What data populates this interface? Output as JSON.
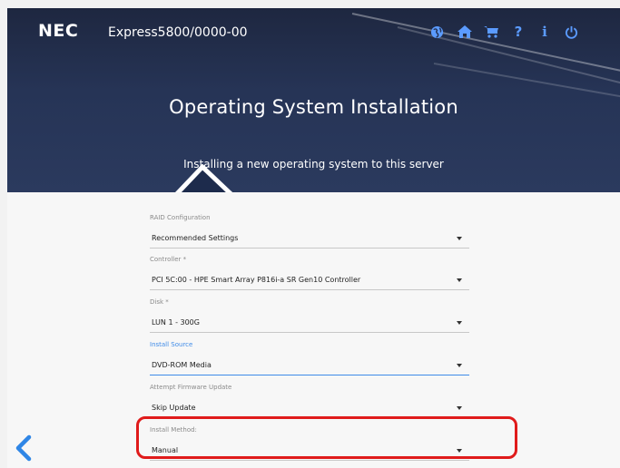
{
  "header": {
    "brand": "NEC",
    "product": "Express5800/0000-00",
    "title": "Operating System Installation",
    "subtitle": "Installing a new operating system to this server",
    "icons": [
      "globe-icon",
      "home-icon",
      "cart-icon",
      "help-icon",
      "info-icon",
      "power-icon"
    ]
  },
  "form": {
    "fields": [
      {
        "label": "RAID Configuration",
        "value": "Recommended Settings"
      },
      {
        "label": "Controller *",
        "value": "PCI 5C:00 - HPE Smart Array P816i-a SR Gen10 Controller"
      },
      {
        "label": "Disk *",
        "value": "LUN 1 - 300G"
      },
      {
        "label": "Install Source",
        "value": "DVD-ROM Media"
      },
      {
        "label": "Attempt Firmware Update",
        "value": "Skip Update"
      },
      {
        "label": "Install Method:",
        "value": "Manual"
      }
    ]
  },
  "colors": {
    "accent": "#3f8be8",
    "highlight": "#e01b1b",
    "header_bg": "#263456"
  }
}
